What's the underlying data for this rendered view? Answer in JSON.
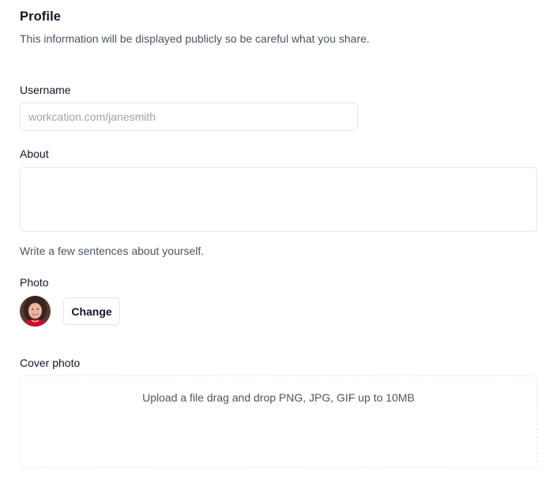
{
  "section": {
    "title": "Profile",
    "description": "This information will be displayed publicly so be careful what you share."
  },
  "username": {
    "label": "Username",
    "placeholder": "workcation.com/janesmith",
    "value": ""
  },
  "about": {
    "label": "About",
    "value": "",
    "helper": "Write a few sentences about yourself."
  },
  "photo": {
    "label": "Photo",
    "avatar_icon": "user-avatar",
    "change_label": "Change"
  },
  "cover_photo": {
    "label": "Cover photo",
    "prompt": "Upload a file drag and drop PNG, JPG, GIF up to 10MB"
  },
  "colors": {
    "text_primary": "#111827",
    "text_secondary": "#4b5563",
    "placeholder": "#9ca3af",
    "border": "#e5e7eb"
  }
}
